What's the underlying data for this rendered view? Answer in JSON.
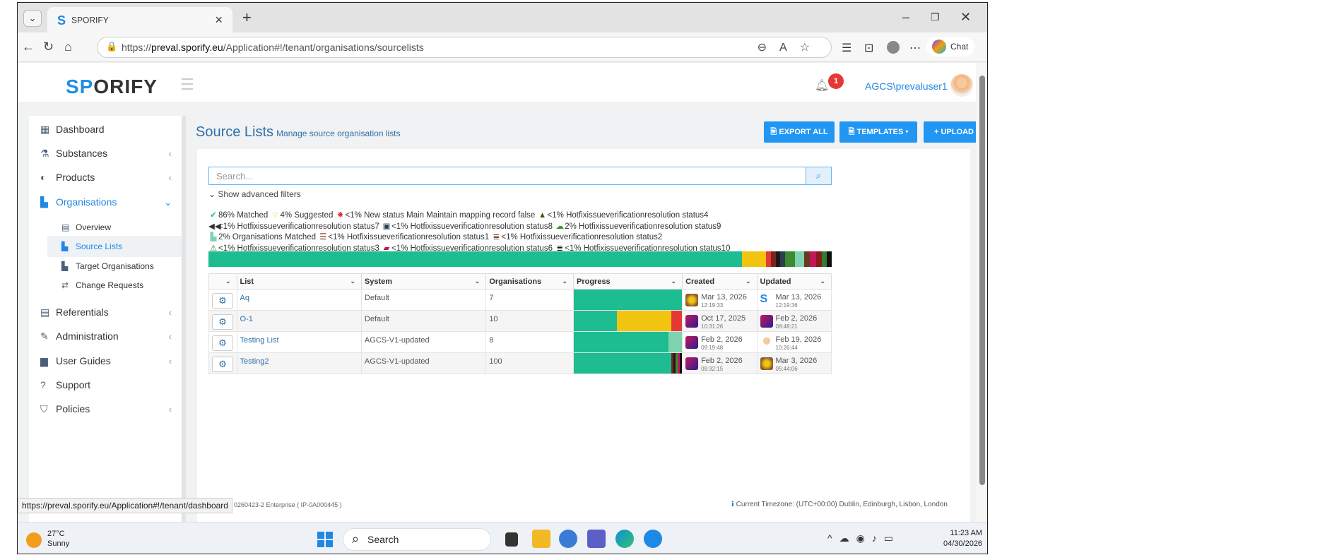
{
  "browser": {
    "tab_title": "SPORIFY",
    "url_prefix": "https://",
    "url_host": "preval.sporify.eu",
    "url_path": "/Application#!/tenant/organisations/sourcelists",
    "chat_label": "Chat",
    "status_url": "https://preval.sporify.eu/Application#!/tenant/dashboard"
  },
  "header": {
    "brand_left": "SP",
    "brand_o": "O",
    "brand_right": "RIFY",
    "notification_count": "1",
    "username": "AGCS\\prevaluser1"
  },
  "sidebar": {
    "items": [
      {
        "label": "Dashboard",
        "icon": "grid-icon"
      },
      {
        "label": "Substances",
        "icon": "flask-icon"
      },
      {
        "label": "Products",
        "icon": "products-icon"
      },
      {
        "label": "Organisations",
        "icon": "factory-icon"
      },
      {
        "label": "Referentials",
        "icon": "list-icon"
      },
      {
        "label": "Administration",
        "icon": "wrench-icon"
      },
      {
        "label": "User Guides",
        "icon": "book-icon"
      },
      {
        "label": "Support",
        "icon": "question-icon"
      },
      {
        "label": "Policies",
        "icon": "shield-icon"
      }
    ],
    "subitems": [
      {
        "label": "Overview"
      },
      {
        "label": "Source Lists"
      },
      {
        "label": "Target Organisations"
      },
      {
        "label": "Change Requests"
      }
    ]
  },
  "page": {
    "title": "Source Lists",
    "subtitle": "Manage source organisation lists",
    "export_all": "EXPORT ALL",
    "templates": "TEMPLATES ▾",
    "upload": "UPLOAD",
    "search_placeholder": "Search...",
    "advanced_filters": "Show advanced filters"
  },
  "legend": {
    "l1": "86% Matched",
    "l2": "4% Suggested",
    "l3": "<1% New status Main Maintain mapping record false",
    "l4": "<1% Hotfixissueverificationresolution status4",
    "l5": "<1% Hotfixissueverificationresolution status7",
    "l6": "<1% Hotfixissueverificationresolution status8",
    "l7": "2% Hotfixissueverificationresolution status9",
    "l8": "2% Organisations Matched",
    "l9": "<1% Hotfixissueverificationresolution status1",
    "l10": "<1% Hotfixissueverificationresolution status2",
    "l11": "<1% Hotfixissueverificationresolution status3",
    "l12": "<1% Hotfixissueverificationresolution status6",
    "l13": "<1% Hotfixissueverificationresolution status10"
  },
  "overall_progress": [
    {
      "pct": 85.6,
      "color": "#1dbc91"
    },
    {
      "pct": 3.9,
      "color": "#f1c40f"
    },
    {
      "pct": 0.8,
      "color": "#e53935"
    },
    {
      "pct": 0.7,
      "color": "#7b241c"
    },
    {
      "pct": 0.7,
      "color": "#1a1a1a"
    },
    {
      "pct": 0.8,
      "color": "#2c3e50"
    },
    {
      "pct": 1.6,
      "color": "#3a8c2f"
    },
    {
      "pct": 1.5,
      "color": "#7fd3b0"
    },
    {
      "pct": 0.9,
      "color": "#6b3a1e"
    },
    {
      "pct": 1.0,
      "color": "#c0185a"
    },
    {
      "pct": 0.9,
      "color": "#8b1a1a"
    },
    {
      "pct": 0.8,
      "color": "#2e7d32"
    },
    {
      "pct": 0.8,
      "color": "#111111"
    }
  ],
  "table": {
    "headers": {
      "list": "List",
      "system": "System",
      "organisations": "Organisations",
      "progress": "Progress",
      "created": "Created",
      "updated": "Updated"
    },
    "rows": [
      {
        "list": "Aq",
        "system": "Default",
        "orgs": "7",
        "progress": [
          {
            "pct": 100,
            "color": "#1dbc91"
          }
        ],
        "created_date": "Mar 13, 2026",
        "created_time": "12:19:33",
        "updated_date": "Mar 13, 2026",
        "updated_time": "12:19:36"
      },
      {
        "list": "O-1",
        "system": "Default",
        "orgs": "10",
        "progress": [
          {
            "pct": 40,
            "color": "#1dbc91"
          },
          {
            "pct": 50,
            "color": "#f1c40f"
          },
          {
            "pct": 10,
            "color": "#e53935"
          }
        ],
        "created_date": "Oct 17, 2025",
        "created_time": "10:31:26",
        "updated_date": "Feb 2, 2026",
        "updated_time": "08:48:21"
      },
      {
        "list": "Testing List",
        "system": "AGCS-V1-updated",
        "orgs": "8",
        "progress": [
          {
            "pct": 87.5,
            "color": "#1dbc91"
          },
          {
            "pct": 12.5,
            "color": "#7fd3b0"
          }
        ],
        "created_date": "Feb 2, 2026",
        "created_time": "09:19:48",
        "updated_date": "Feb 19, 2026",
        "updated_time": "10:26:44"
      },
      {
        "list": "Testing2",
        "system": "AGCS-V1-updated",
        "orgs": "100",
        "progress": [
          {
            "pct": 90,
            "color": "#1dbc91"
          },
          {
            "pct": 2,
            "color": "#7b241c"
          },
          {
            "pct": 2,
            "color": "#1a1a1a"
          },
          {
            "pct": 2,
            "color": "#3a8c2f"
          },
          {
            "pct": 2,
            "color": "#c0185a"
          },
          {
            "pct": 2,
            "color": "#111111"
          }
        ],
        "created_date": "Feb 2, 2026",
        "created_time": "09:32:15",
        "updated_date": "Mar 3, 2026",
        "updated_time": "05:44:06"
      }
    ]
  },
  "footer": {
    "version": "0260423-2 Enterprise",
    "version_code": "( IP-0A000445 )",
    "timezone": "Current Timezone: (UTC+00:00) Dublin, Edinburgh, Lisbon, London"
  },
  "taskbar": {
    "temp": "27°C",
    "weather": "Sunny",
    "search": "Search",
    "time": "11:23 AM",
    "date": "04/30/2026"
  }
}
